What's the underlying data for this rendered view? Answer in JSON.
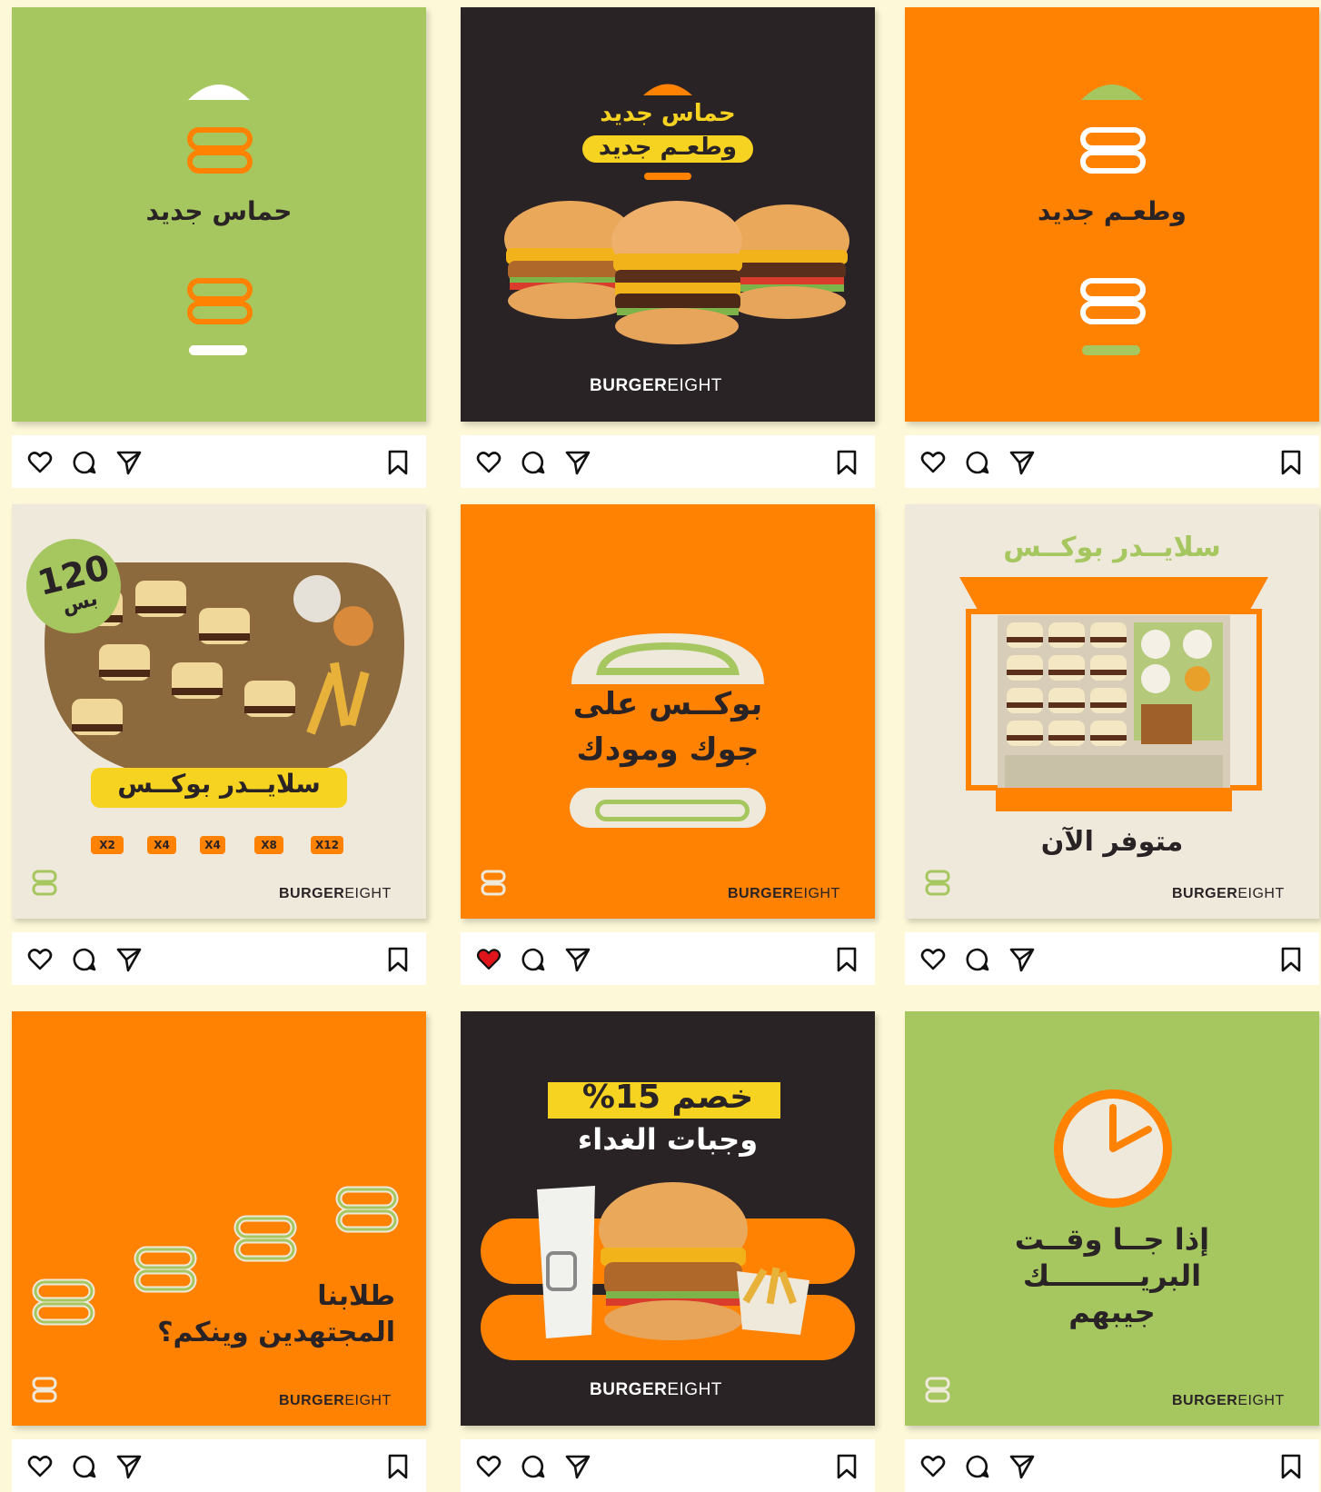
{
  "brand": {
    "bold": "BURGER",
    "light": "EIGHT"
  },
  "colors": {
    "green": "#a6c75f",
    "orange": "#ff8203",
    "dark": "#2a2326",
    "cream": "#efe9dc",
    "yellow": "#f7d321",
    "heart_red": "#e0151c"
  },
  "posts": [
    {
      "headline": "حماس جديد"
    },
    {
      "line1": "حماس جديد",
      "line2": "وطعـم جديد"
    },
    {
      "headline": "وطعـم جديد"
    },
    {
      "price_number": "120",
      "price_unit": "بس",
      "banner": "سلايــدر بوكــس",
      "sizes": [
        "X2",
        "X4",
        "X4",
        "X8",
        "X12"
      ]
    },
    {
      "line1": "بوكــس على",
      "line2": "جوك ومودك"
    },
    {
      "title": "سلايــدر بوكــس",
      "caption": "متوفر الآن"
    },
    {
      "line1": "طلابنا",
      "line2": "المجتهدين وينكم؟"
    },
    {
      "badge": "خصم 15%",
      "subtitle": "وجبات الغداء"
    },
    {
      "line1": "إذا جــا وقــت",
      "line2": "البريـــــــــك",
      "line3": "جيبهم"
    }
  ],
  "icons": {
    "like": "heart-icon",
    "comment": "comment-icon",
    "share": "send-icon",
    "save": "bookmark-icon"
  },
  "liked_post": 5
}
